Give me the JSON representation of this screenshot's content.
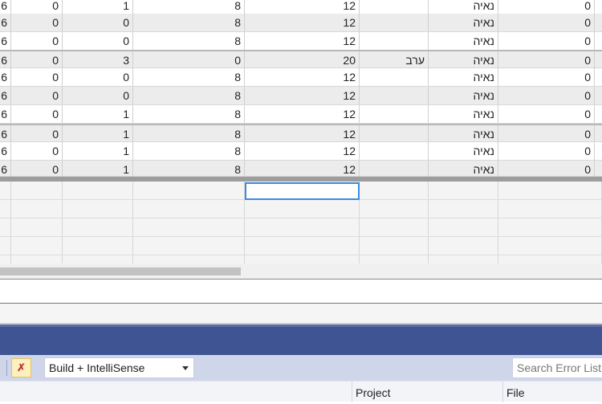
{
  "grid": {
    "rows": [
      {
        "c0": "6",
        "c1": "0",
        "c2": "1",
        "c3": "8",
        "c4": "12",
        "c5": "",
        "c6": "נאיה",
        "c7": "0"
      },
      {
        "c0": "6",
        "c1": "0",
        "c2": "0",
        "c3": "8",
        "c4": "12",
        "c5": "",
        "c6": "נאיה",
        "c7": "0"
      },
      {
        "c0": "6",
        "c1": "0",
        "c2": "0",
        "c3": "8",
        "c4": "12",
        "c5": "",
        "c6": "נאיה",
        "c7": "0"
      },
      {
        "c0": "6",
        "c1": "0",
        "c2": "3",
        "c3": "0",
        "c4": "20",
        "c5": "ערב",
        "c6": "נאיה",
        "c7": "0"
      },
      {
        "c0": "6",
        "c1": "0",
        "c2": "0",
        "c3": "8",
        "c4": "12",
        "c5": "",
        "c6": "נאיה",
        "c7": "0"
      },
      {
        "c0": "6",
        "c1": "0",
        "c2": "0",
        "c3": "8",
        "c4": "12",
        "c5": "",
        "c6": "נאיה",
        "c7": "0"
      },
      {
        "c0": "6",
        "c1": "0",
        "c2": "1",
        "c3": "8",
        "c4": "12",
        "c5": "",
        "c6": "נאיה",
        "c7": "0"
      },
      {
        "c0": "6",
        "c1": "0",
        "c2": "1",
        "c3": "8",
        "c4": "12",
        "c5": "",
        "c6": "נאיה",
        "c7": "0"
      },
      {
        "c0": "6",
        "c1": "0",
        "c2": "1",
        "c3": "8",
        "c4": "12",
        "c5": "",
        "c6": "נאיה",
        "c7": "0"
      },
      {
        "c0": "6",
        "c1": "0",
        "c2": "1",
        "c3": "8",
        "c4": "12",
        "c5": "",
        "c6": "נאיה",
        "c7": "0"
      }
    ]
  },
  "error_list": {
    "scope_dropdown": "Build + IntelliSense",
    "search_placeholder": "Search Error List",
    "columns": {
      "project": "Project",
      "file": "File"
    },
    "filter_icon": "clear-filter-icon"
  }
}
